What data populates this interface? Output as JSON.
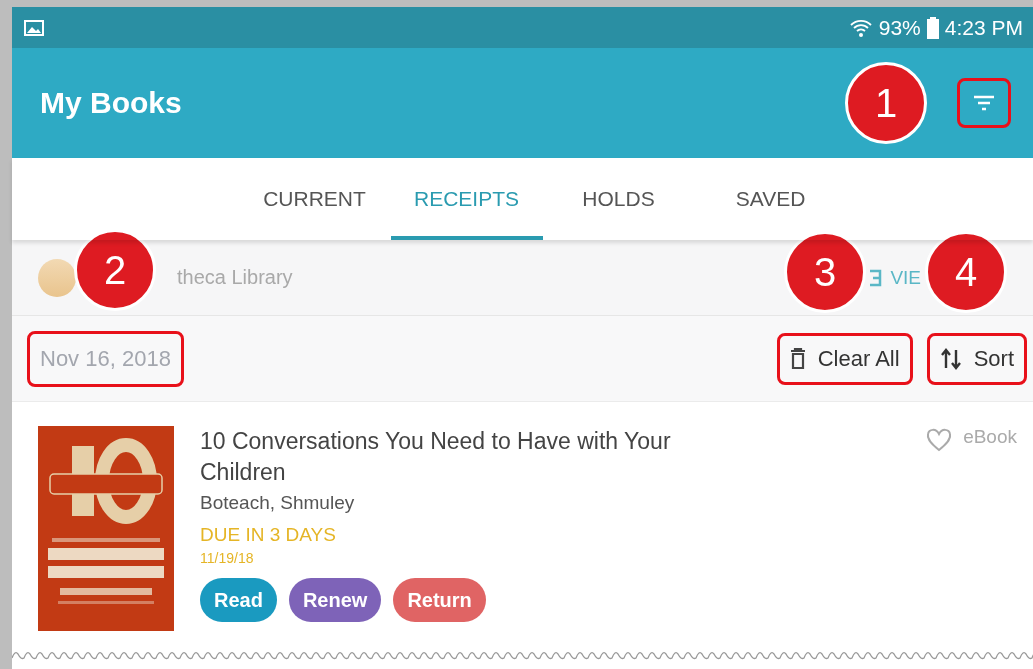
{
  "status_bar": {
    "battery": "93%",
    "time": "4:23 PM"
  },
  "app_bar": {
    "title": "My Books",
    "filter_highlighted": true
  },
  "tabs": [
    {
      "label": "CURRENT",
      "selected": false
    },
    {
      "label": "RECEIPTS",
      "selected": true
    },
    {
      "label": "HOLDS",
      "selected": false
    },
    {
      "label": "SAVED",
      "selected": false
    }
  ],
  "library_row": {
    "name": "theca Library",
    "view_label": "VIE"
  },
  "date_row": {
    "date": "Nov 16, 2018",
    "date_highlighted": true,
    "actions": [
      {
        "label": "Clear All",
        "kind": "clear",
        "highlighted": true
      },
      {
        "label": "Sort",
        "kind": "sort",
        "highlighted": true
      }
    ]
  },
  "books": [
    {
      "title": "10 Conversations You Need to Have with Your Children",
      "author": "Boteach, Shmuley",
      "due": "DUE IN 3 DAYS",
      "due_date": "11/19/18",
      "favorite": false,
      "format": "eBook",
      "cover": {
        "kind": "picture"
      },
      "actions": [
        {
          "label": "Read",
          "color": "#1a9ac0"
        },
        {
          "label": "Renew",
          "color": "#7e63b8"
        },
        {
          "label": "Return",
          "color": "#e06464"
        }
      ]
    }
  ],
  "callouts": [
    {
      "number": "1"
    },
    {
      "number": "2"
    },
    {
      "number": "3"
    },
    {
      "number": "4"
    }
  ]
}
